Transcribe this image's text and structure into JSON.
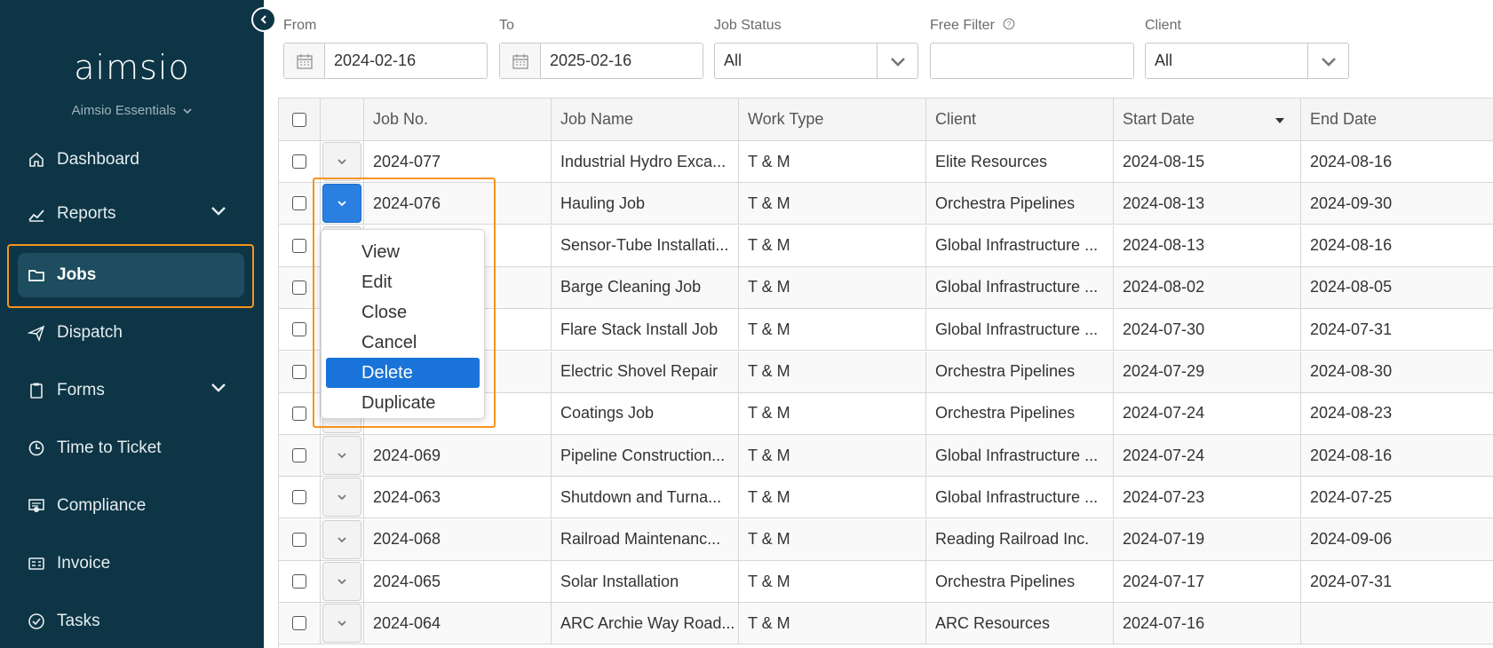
{
  "sidebar": {
    "logo": "aimsio",
    "org": "Aimsio Essentials",
    "items": [
      {
        "label": "Dashboard",
        "icon": "home-icon"
      },
      {
        "label": "Reports",
        "icon": "chart-icon"
      },
      {
        "label": "Jobs",
        "icon": "folder-icon"
      },
      {
        "label": "Dispatch",
        "icon": "paper-plane-icon"
      },
      {
        "label": "Forms",
        "icon": "clipboard-icon"
      },
      {
        "label": "Time to Ticket",
        "icon": "clock-icon"
      },
      {
        "label": "Compliance",
        "icon": "certificate-icon"
      },
      {
        "label": "Invoice",
        "icon": "invoice-icon"
      },
      {
        "label": "Tasks",
        "icon": "check-circle-icon"
      }
    ]
  },
  "filters": {
    "from_label": "From",
    "from_value": "2024-02-16",
    "to_label": "To",
    "to_value": "2025-02-16",
    "status_label": "Job Status",
    "status_value": "All",
    "free_label": "Free Filter",
    "free_value": "",
    "client_label": "Client",
    "client_value": "All"
  },
  "table": {
    "headers": {
      "job_no": "Job No.",
      "job_name": "Job Name",
      "work_type": "Work Type",
      "client": "Client",
      "start": "Start Date",
      "end": "End Date"
    },
    "rows": [
      {
        "job_no": "2024-077",
        "job_name": "Industrial Hydro Exca...",
        "work_type": "T & M",
        "client": "Elite Resources",
        "start": "2024-08-15",
        "end": "2024-08-16"
      },
      {
        "job_no": "2024-076",
        "job_name": "Hauling Job",
        "work_type": "T & M",
        "client": "Orchestra Pipelines",
        "start": "2024-08-13",
        "end": "2024-09-30"
      },
      {
        "job_no": "",
        "job_name": "Sensor-Tube Installati...",
        "work_type": "T & M",
        "client": "Global Infrastructure ...",
        "start": "2024-08-13",
        "end": "2024-08-16"
      },
      {
        "job_no": "",
        "job_name": "Barge Cleaning Job",
        "work_type": "T & M",
        "client": "Global Infrastructure ...",
        "start": "2024-08-02",
        "end": "2024-08-05"
      },
      {
        "job_no": "",
        "job_name": "Flare Stack Install Job",
        "work_type": "T & M",
        "client": "Global Infrastructure ...",
        "start": "2024-07-30",
        "end": "2024-07-31"
      },
      {
        "job_no": "",
        "job_name": "Electric Shovel Repair",
        "work_type": "T & M",
        "client": "Orchestra Pipelines",
        "start": "2024-07-29",
        "end": "2024-08-30"
      },
      {
        "job_no": "",
        "job_name": "Coatings Job",
        "work_type": "T & M",
        "client": "Orchestra Pipelines",
        "start": "2024-07-24",
        "end": "2024-08-23"
      },
      {
        "job_no": "2024-069",
        "job_name": "Pipeline Construction...",
        "work_type": "T & M",
        "client": "Global Infrastructure ...",
        "start": "2024-07-24",
        "end": "2024-08-16"
      },
      {
        "job_no": "2024-063",
        "job_name": "Shutdown and Turna...",
        "work_type": "T & M",
        "client": "Global Infrastructure ...",
        "start": "2024-07-23",
        "end": "2024-07-25"
      },
      {
        "job_no": "2024-068",
        "job_name": "Railroad Maintenanc...",
        "work_type": "T & M",
        "client": "Reading Railroad Inc.",
        "start": "2024-07-19",
        "end": "2024-09-06"
      },
      {
        "job_no": "2024-065",
        "job_name": "Solar Installation",
        "work_type": "T & M",
        "client": "Orchestra Pipelines",
        "start": "2024-07-17",
        "end": "2024-07-31"
      },
      {
        "job_no": "2024-064",
        "job_name": "ARC Archie Way Road...",
        "work_type": "T & M",
        "client": "ARC Resources",
        "start": "2024-07-16",
        "end": ""
      }
    ]
  },
  "menu": {
    "items": [
      "View",
      "Edit",
      "Close",
      "Cancel",
      "Delete",
      "Duplicate"
    ],
    "selected": "Delete"
  },
  "colors": {
    "sidebar_bg": "#0d3545",
    "highlight": "#f7941d",
    "accent": "#1a73d9"
  }
}
